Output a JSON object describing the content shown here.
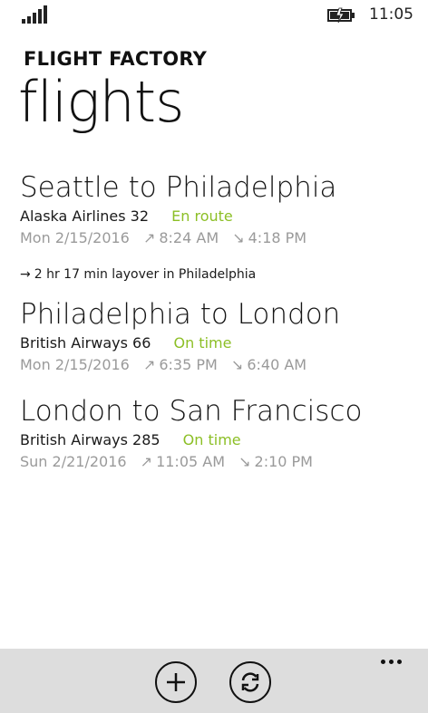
{
  "status_bar": {
    "time": "11:05",
    "signal_icon": "signal-strength-icon",
    "battery_icon": "battery-charging-icon"
  },
  "header": {
    "app_title": "FLIGHT FACTORY",
    "page_title": "flights"
  },
  "flights": [
    {
      "route": "Seattle to Philadelphia",
      "airline": "Alaska Airlines 32",
      "status": "En route",
      "date": "Mon 2/15/2016",
      "depart_arrow": "↗",
      "depart": "8:24 AM",
      "arrive_arrow": "↘",
      "arrive": "4:18 PM"
    },
    {
      "route": "Philadelphia to London",
      "airline": "British Airways 66",
      "status": "On time",
      "date": "Mon 2/15/2016",
      "depart_arrow": "↗",
      "depart": "6:35 PM",
      "arrive_arrow": "↘",
      "arrive": "6:40 AM"
    },
    {
      "route": "London to San Francisco",
      "airline": "British Airways 285",
      "status": "On time",
      "date": "Sun 2/21/2016",
      "depart_arrow": "↗",
      "depart": "11:05 AM",
      "arrive_arrow": "↘",
      "arrive": "2:10 PM"
    }
  ],
  "layover": {
    "arrow": "→",
    "text": "2 hr 17 min layover in Philadelphia"
  },
  "app_bar": {
    "add_icon": "add-icon",
    "sync_icon": "sync-icon",
    "more_icon": "more-icon"
  },
  "colors": {
    "status_green": "#8cbf26",
    "secondary_gray": "#9a9a9a",
    "app_bar_bg": "#dddddd"
  }
}
